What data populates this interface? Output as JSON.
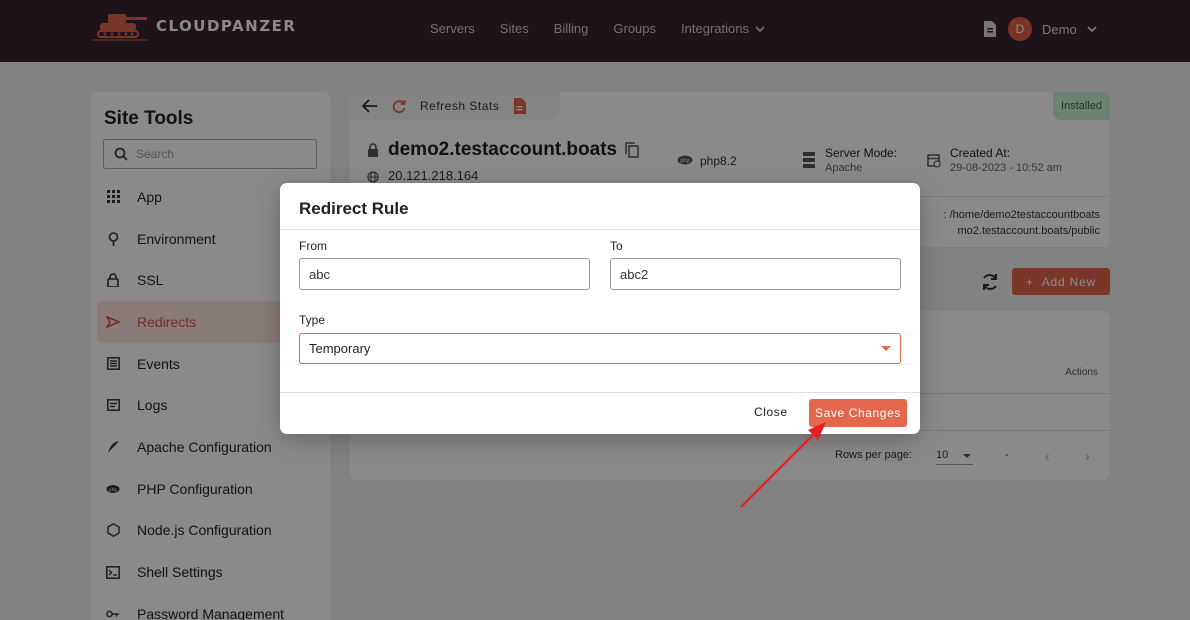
{
  "brand": {
    "name": "CLOUDPANZER"
  },
  "nav": {
    "servers": "Servers",
    "sites": "Sites",
    "billing": "Billing",
    "groups": "Groups",
    "integrations": "Integrations"
  },
  "user": {
    "initial": "D",
    "name": "Demo"
  },
  "sidebar": {
    "title": "Site Tools",
    "search_placeholder": "Search",
    "items": [
      {
        "label": "App",
        "icon": "grid-icon"
      },
      {
        "label": "Environment",
        "icon": "pin-icon"
      },
      {
        "label": "SSL",
        "icon": "lock-icon"
      },
      {
        "label": "Redirects",
        "icon": "redirect-icon",
        "active": true
      },
      {
        "label": "Events",
        "icon": "list-icon"
      },
      {
        "label": "Logs",
        "icon": "log-icon"
      },
      {
        "label": "Apache Configuration",
        "icon": "feather-icon"
      },
      {
        "label": "PHP Configuration",
        "icon": "php-icon"
      },
      {
        "label": "Node.js Configuration",
        "icon": "nodejs-icon"
      },
      {
        "label": "Shell Settings",
        "icon": "terminal-icon"
      },
      {
        "label": "Password Management",
        "icon": "key-icon"
      }
    ]
  },
  "site": {
    "refresh_label": "Refresh Stats",
    "status": "Installed",
    "domain": "demo2.testaccount.boats",
    "ip": "20.121.218.164",
    "php": "php8.2",
    "server_mode_label": "Server Mode:",
    "server_mode_value": "Apache",
    "created_label": "Created At:",
    "created_value": "29-08-2023 - 10:52 am",
    "path_line1": ": /home/demo2testaccountboats",
    "path_line2": "mo2.testaccount.boats/public"
  },
  "redirects": {
    "add_new_label": "Add New",
    "actions_header": "Actions",
    "rows_per_page_label": "Rows per page:",
    "rows_per_page_value": "10",
    "range": "-"
  },
  "modal": {
    "title": "Redirect Rule",
    "from_label": "From",
    "from_value": "abc",
    "to_label": "To",
    "to_value": "abc2",
    "type_label": "Type",
    "type_value": "Temporary",
    "close_label": "Close",
    "save_label": "Save Changes"
  },
  "colors": {
    "topbar": "#3a2430",
    "accent": "#e2674d",
    "annotation_arrow": "#e02020"
  }
}
